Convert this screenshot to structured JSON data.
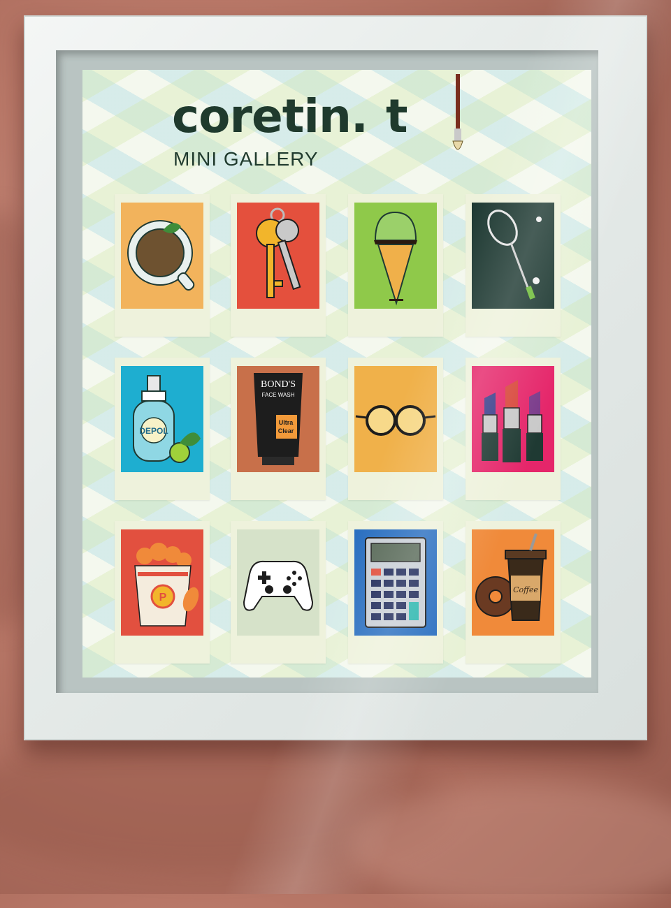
{
  "poster": {
    "brand": "coretin.",
    "brand_suffix": "t",
    "subtitle": "MINI GALLERY"
  },
  "colors": {
    "frame": "#e9eeec",
    "brand_text": "#1f3a2d",
    "background_fabric": "#b97868"
  },
  "gallery": [
    {
      "icon": "tea-cup-icon",
      "bg": "#f2b35c"
    },
    {
      "icon": "keys-icon",
      "bg": "#e4503d"
    },
    {
      "icon": "ice-cream-icon",
      "bg": "#8fc94a"
    },
    {
      "icon": "badminton-racket-icon",
      "bg": "#1f3a33"
    },
    {
      "icon": "spray-bottle-icon",
      "bg": "#1eaed0"
    },
    {
      "icon": "face-wash-icon",
      "bg": "#c8704a"
    },
    {
      "icon": "glasses-icon",
      "bg": "#f0b14a"
    },
    {
      "icon": "lipsticks-icon",
      "bg": "#e5266a"
    },
    {
      "icon": "fried-chicken-bucket-icon",
      "bg": "#e2503f"
    },
    {
      "icon": "game-controller-icon",
      "bg": "#d6e2c9"
    },
    {
      "icon": "calculator-icon",
      "bg": "#2a6fc0"
    },
    {
      "icon": "coffee-donut-icon",
      "bg": "#f08a3a"
    }
  ],
  "labels": {
    "face_wash_brand": "BOND'S",
    "face_wash_type": "FACE WASH",
    "face_wash_line1": "Ultra",
    "face_wash_line2": "Clear",
    "spray_brand": "DEPOL",
    "coffee_label": "Coffee"
  }
}
